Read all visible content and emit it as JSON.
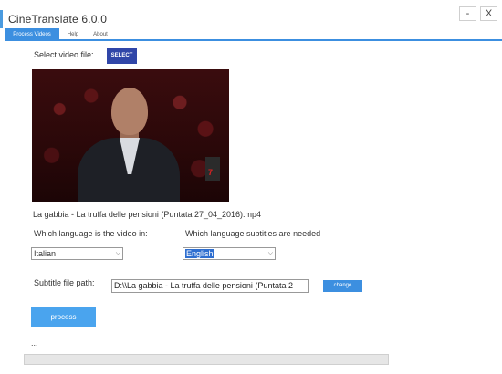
{
  "window": {
    "title": "CineTranslate 6.0.0",
    "minimize_label": "-",
    "close_label": "X"
  },
  "tabs": [
    {
      "label": "Process Videos",
      "active": true
    },
    {
      "label": "Help",
      "active": false
    },
    {
      "label": "About",
      "active": false
    }
  ],
  "video_file": {
    "label": "Select video file:",
    "select_button": "SELECT",
    "filename": "La gabbia - La truffa delle pensioni (Puntata 27_04_2016).mp4"
  },
  "languages": {
    "source_label": "Which language is the video in:",
    "source_value": "Italian",
    "target_label": "Which language subtitles are needed",
    "target_value": "English"
  },
  "subtitle": {
    "label": "Subtitle file path:",
    "path_value": "D:\\\\La gabbia - La truffa delle pensioni (Puntata 2",
    "change_button": "change"
  },
  "actions": {
    "process_button": "process",
    "status_text": "..."
  },
  "progress": {
    "fraction": 0
  },
  "colors": {
    "accent": "#3c8fe0",
    "select_button": "#3046a8",
    "process_button": "#4aa4ee"
  }
}
